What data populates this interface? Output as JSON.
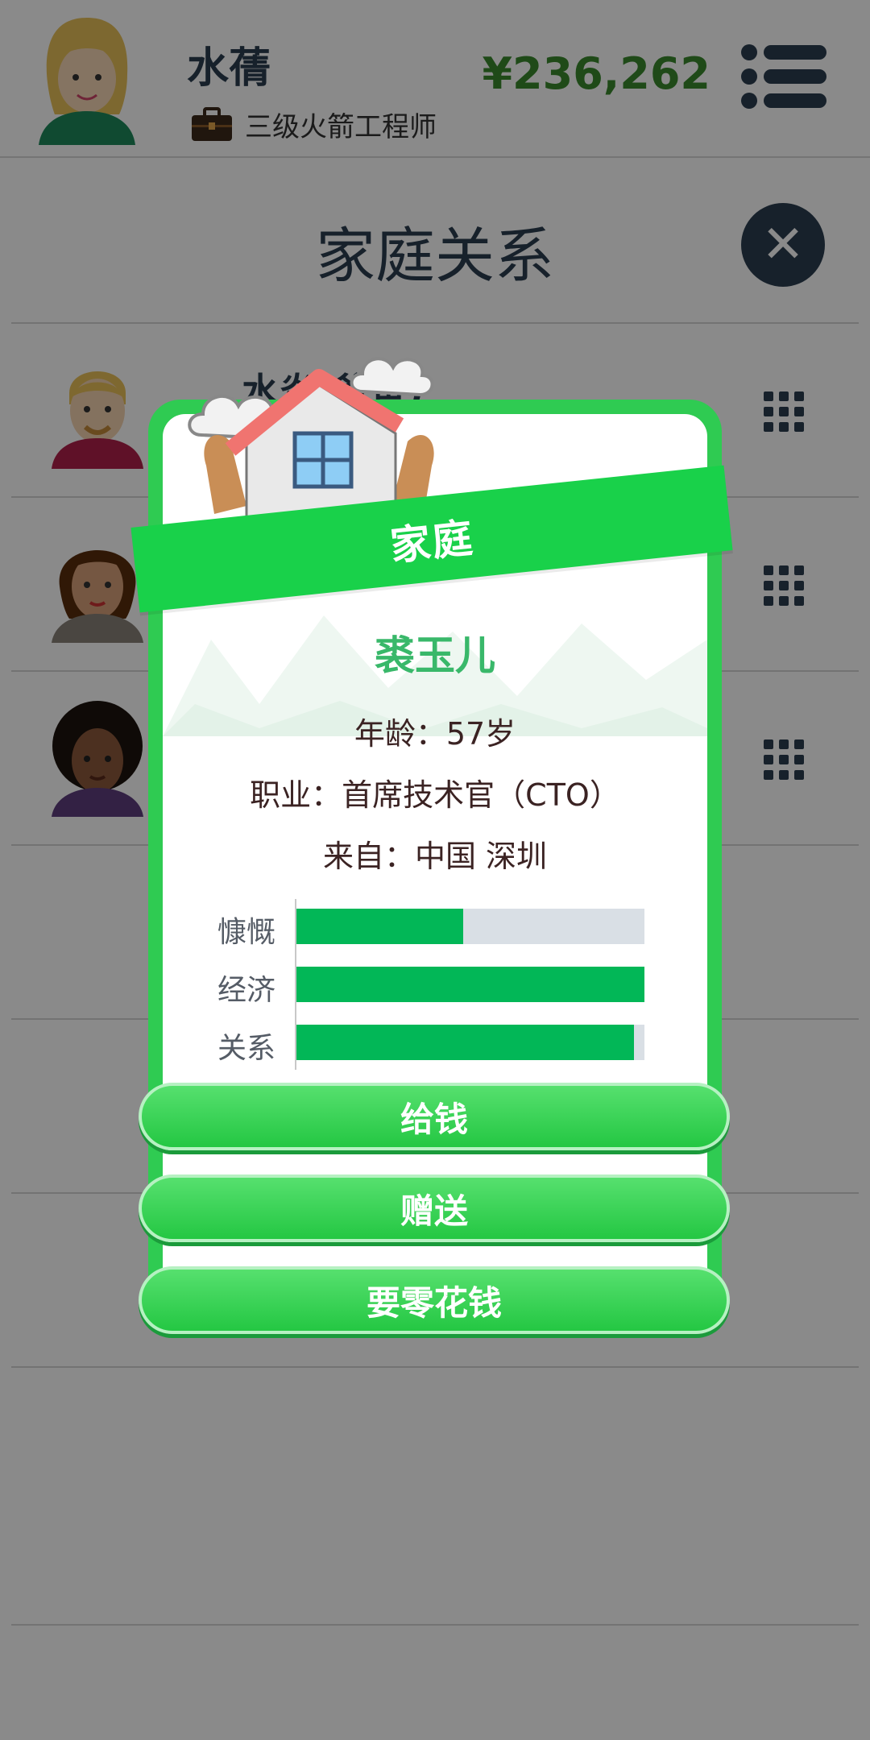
{
  "header": {
    "user_name": "水蒨",
    "job_title": "三级火箭工程师",
    "money": "¥236,262"
  },
  "page": {
    "title": "家庭关系"
  },
  "family_list": [
    {
      "name": "水炎(爸爸)"
    },
    {
      "name": ""
    },
    {
      "name": ""
    }
  ],
  "modal": {
    "ribbon_title": "家庭",
    "person_name": "裘玉儿",
    "age_line": "年龄：57岁",
    "job_line": "职业：首席技术官（CTO）",
    "from_line": "来自：中国 深圳",
    "stats": [
      {
        "label": "慷慨",
        "value": 0.48
      },
      {
        "label": "经济",
        "value": 1.0
      },
      {
        "label": "关系",
        "value": 0.97
      }
    ],
    "buttons": [
      "给钱",
      "赠送",
      "要零花钱"
    ]
  },
  "colors": {
    "accent_green": "#19d14a",
    "money_green": "#3a8a2e",
    "dark_navy": "#2c3e50",
    "bar_fill": "#02b757"
  },
  "icons": [
    "briefcase-icon",
    "menu-icon",
    "close-icon",
    "grid-menu-icon",
    "house-icon",
    "cloud-icon"
  ]
}
